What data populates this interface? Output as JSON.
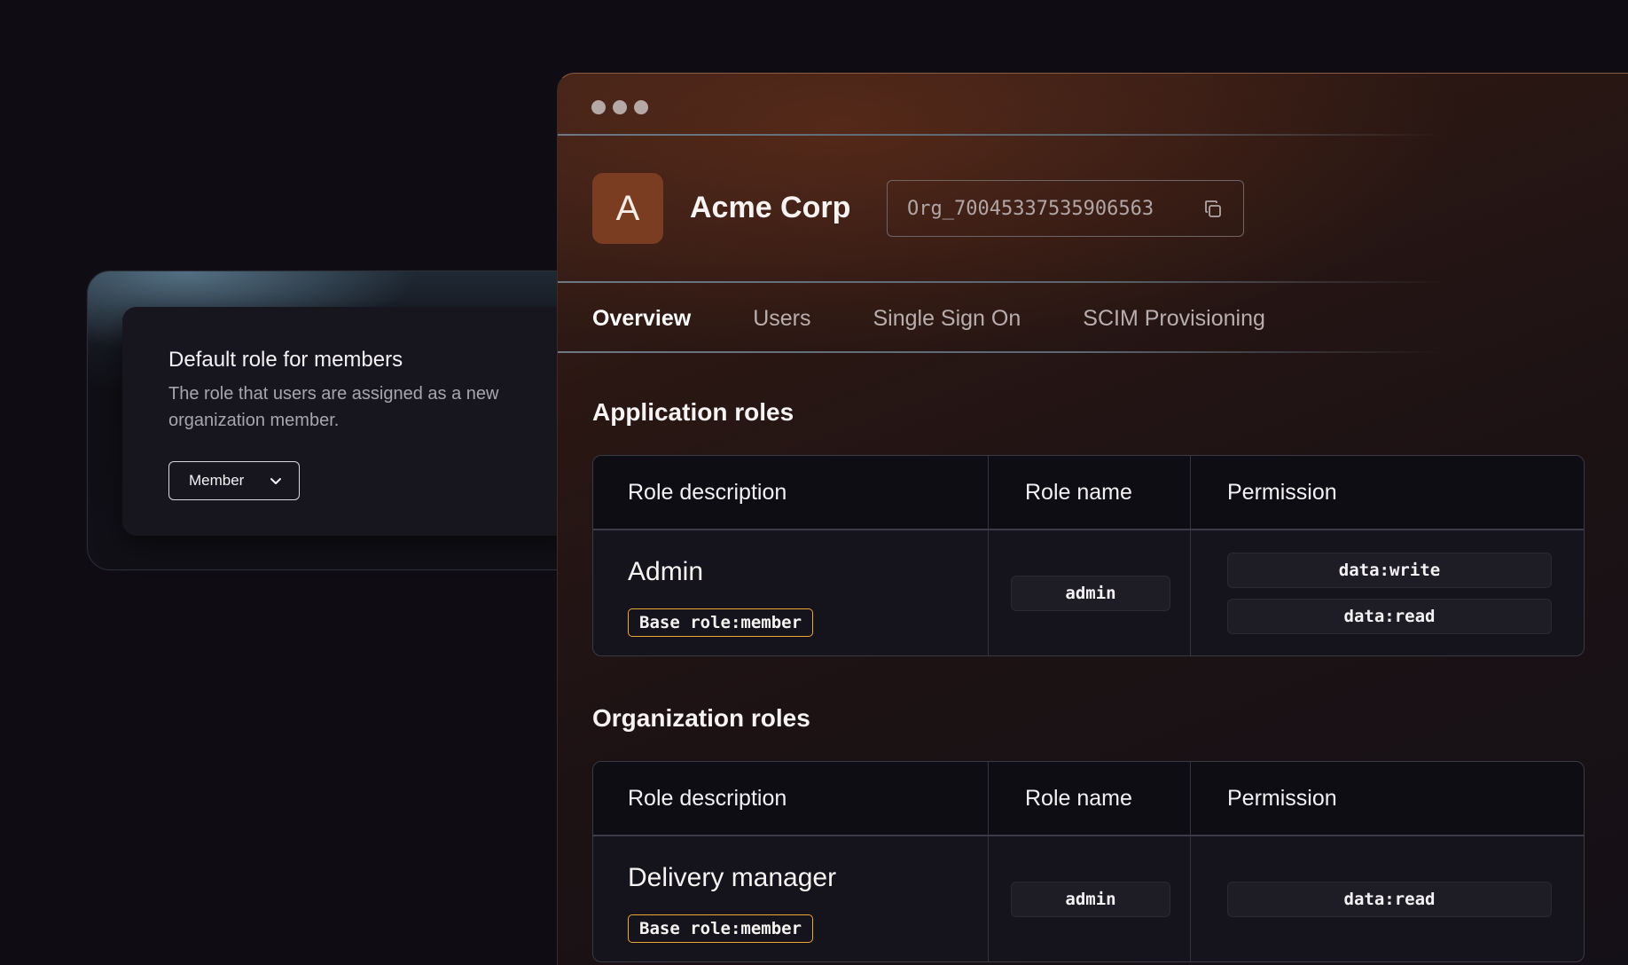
{
  "side_card": {
    "title": "Default role for members",
    "description": "The role that users are assigned as a new organization member.",
    "select_value": "Member"
  },
  "org": {
    "avatar_letter": "A",
    "name": "Acme Corp",
    "id": "Org_70045337535906563"
  },
  "tabs": [
    {
      "label": "Overview",
      "active": true
    },
    {
      "label": "Users",
      "active": false
    },
    {
      "label": "Single Sign On",
      "active": false
    },
    {
      "label": "SCIM Provisioning",
      "active": false
    }
  ],
  "application_roles": {
    "title": "Application roles",
    "headers": [
      "Role description",
      "Role name",
      "Permission"
    ],
    "rows": [
      {
        "description": "Admin",
        "base_role": "Base role:member",
        "role_name": "admin",
        "permissions": [
          "data:write",
          "data:read"
        ]
      }
    ]
  },
  "organization_roles": {
    "title": "Organization roles",
    "headers": [
      "Role description",
      "Role name",
      "Permission"
    ],
    "rows": [
      {
        "description": "Delivery manager",
        "base_role": "Base role:member",
        "role_name": "admin",
        "permissions": [
          "data:read"
        ]
      }
    ]
  },
  "colors": {
    "background": "#0f0d13",
    "avatar": "#7a3d22",
    "badge_border": "#f0a733"
  }
}
